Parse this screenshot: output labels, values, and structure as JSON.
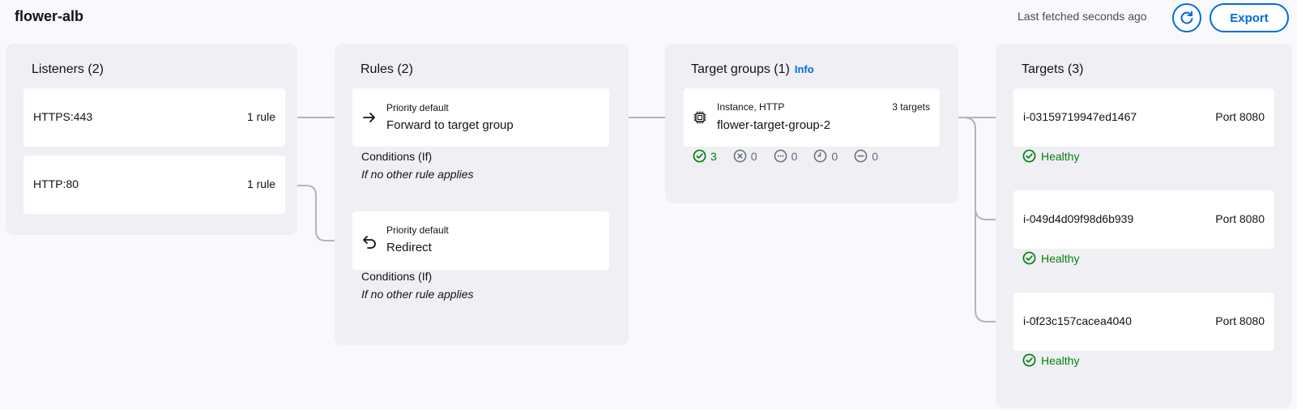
{
  "header": {
    "title": "flower-alb",
    "last_fetched": "Last fetched seconds ago",
    "refresh_icon": "refresh-icon",
    "export_label": "Export"
  },
  "listeners": {
    "title": "Listeners (2)",
    "items": [
      {
        "protocol": "HTTPS:443",
        "rules": "1 rule"
      },
      {
        "protocol": "HTTP:80",
        "rules": "1 rule"
      }
    ]
  },
  "rules": {
    "title": "Rules (2)",
    "items": [
      {
        "icon": "arrow-right-icon",
        "priority": "Priority default",
        "action": "Forward to target group",
        "conditions_label": "Conditions (If)",
        "conditions_value": "If no other rule applies"
      },
      {
        "icon": "redirect-icon",
        "priority": "Priority default",
        "action": "Redirect",
        "conditions_label": "Conditions (If)",
        "conditions_value": "If no other rule applies"
      }
    ]
  },
  "target_groups": {
    "title": "Target groups (1)",
    "info": "Info",
    "items": [
      {
        "type": "Instance, HTTP",
        "count": "3 targets",
        "name": "flower-target-group-2",
        "status": [
          {
            "icon": "check-circle-icon",
            "value": "3",
            "color": "#037f0c"
          },
          {
            "icon": "x-circle-icon",
            "value": "0",
            "color": "#5f6b7a"
          },
          {
            "icon": "dots-circle-icon",
            "value": "0",
            "color": "#5f6b7a"
          },
          {
            "icon": "clock-circle-icon",
            "value": "0",
            "color": "#5f6b7a"
          },
          {
            "icon": "minus-circle-icon",
            "value": "0",
            "color": "#5f6b7a"
          }
        ]
      }
    ]
  },
  "targets": {
    "title": "Targets (3)",
    "items": [
      {
        "id": "i-03159719947ed1467",
        "port": "Port 8080",
        "health": "Healthy"
      },
      {
        "id": "i-049d4d09f98d6b939",
        "port": "Port 8080",
        "health": "Healthy"
      },
      {
        "id": "i-0f23c157cacea4040",
        "port": "Port 8080",
        "health": "Healthy"
      }
    ]
  },
  "colors": {
    "accent": "#006ce0",
    "healthy": "#037f0c",
    "connector": "#b4b4bb"
  }
}
